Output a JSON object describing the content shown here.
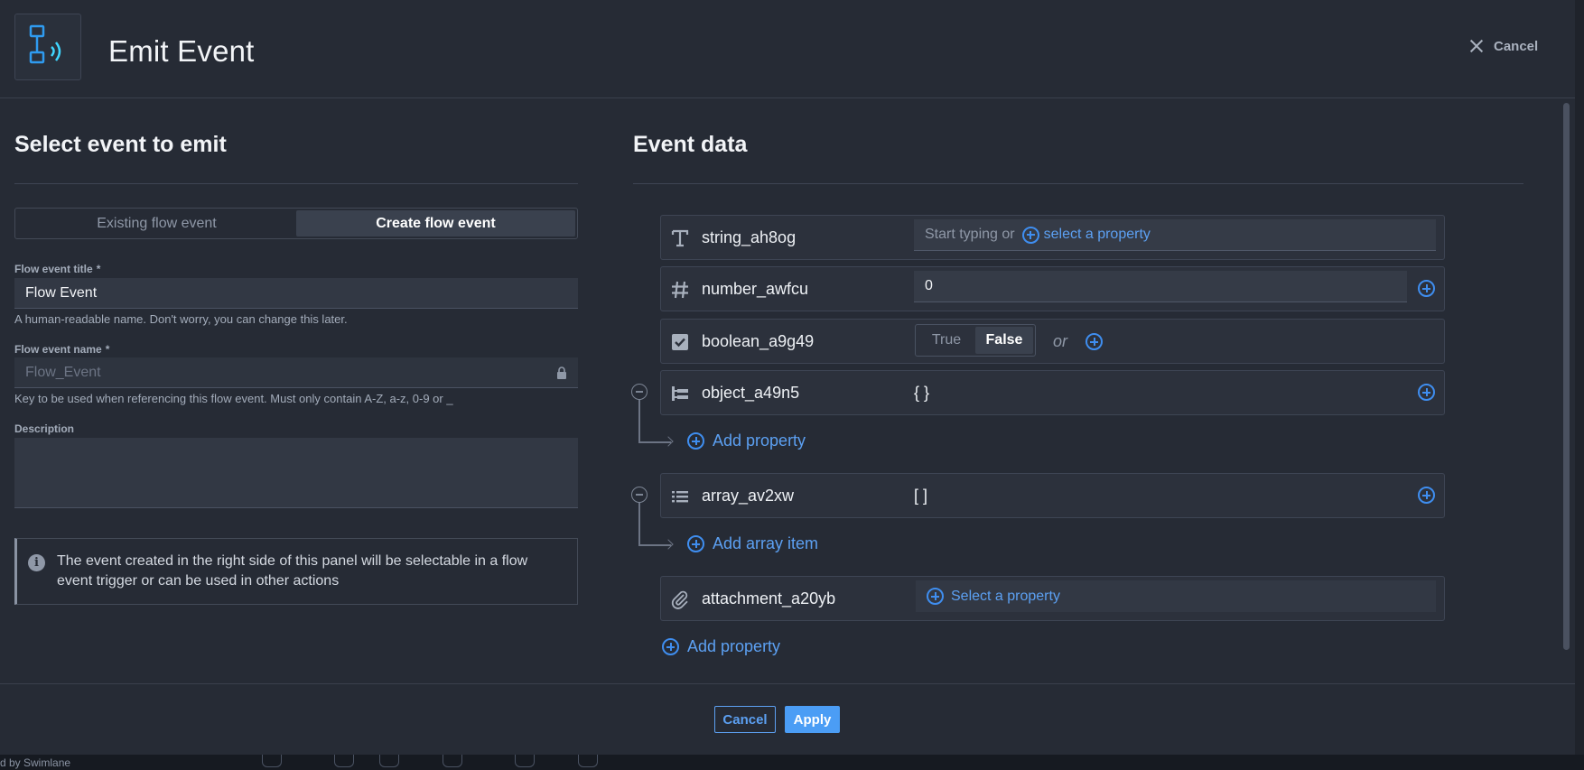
{
  "header": {
    "title": "Emit Event",
    "cancel_label": "Cancel",
    "icon": "flow-event-broadcast-icon"
  },
  "left": {
    "section_title": "Select event to emit",
    "tabs": [
      {
        "label": "Existing flow event",
        "active": false
      },
      {
        "label": "Create flow event",
        "active": true
      }
    ],
    "title_field": {
      "label": "Flow event title",
      "required_mark": "*",
      "value": "Flow Event",
      "help": "A human-readable name. Don't worry, you can change this later."
    },
    "name_field": {
      "label": "Flow event name",
      "required_mark": "*",
      "value": "Flow_Event",
      "help": "Key to be used when referencing this flow event. Must only contain A-Z, a-z, 0-9 or _"
    },
    "description_field": {
      "label": "Description",
      "value": ""
    },
    "info_text": "The event created in the right side of this panel will be selectable in a flow event trigger or can be used in other actions"
  },
  "right": {
    "section_title": "Event data",
    "rows": {
      "string": {
        "name": "string_ah8og",
        "placeholder": "Start typing or",
        "link": "select a property",
        "icon": "text-type-icon"
      },
      "number": {
        "name": "number_awfcu",
        "value": "0",
        "icon": "hash-icon"
      },
      "boolean": {
        "name": "boolean_a9g49",
        "true_label": "True",
        "false_label": "False",
        "selected": "False",
        "or_label": "or",
        "icon": "checkbox-icon"
      },
      "object": {
        "name": "object_a49n5",
        "value": "{ }",
        "icon": "object-tree-icon",
        "add_label": "Add property"
      },
      "array": {
        "name": "array_av2xw",
        "value": "[ ]",
        "icon": "list-icon",
        "add_label": "Add array item"
      },
      "attachment": {
        "name": "attachment_a20yb",
        "link": "Select a property",
        "icon": "paperclip-icon"
      }
    },
    "add_property_label": "Add property"
  },
  "footer": {
    "cancel_label": "Cancel",
    "apply_label": "Apply"
  },
  "background": {
    "text": "d by Swimlane"
  },
  "colors": {
    "accent": "#3f8ef0",
    "primary_button": "#4b9df5",
    "panel": "#262b35",
    "row": "#2c313c"
  }
}
